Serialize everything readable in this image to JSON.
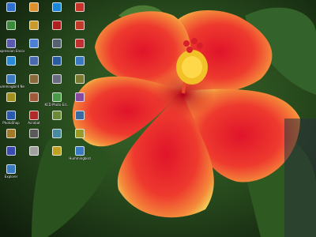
{
  "desktop": {
    "icons": [
      {
        "label": "",
        "icon": "computer-icon",
        "color": "#2f6fd0"
      },
      {
        "label": "",
        "icon": "browser-icon",
        "color": "#e0902a"
      },
      {
        "label": "",
        "icon": "media-icon",
        "color": "#1c86d8"
      },
      {
        "label": "",
        "icon": "app-icon",
        "color": "#c8342a"
      },
      {
        "label": "",
        "icon": "network-icon",
        "color": "#3a8a3a"
      },
      {
        "label": "",
        "icon": "folder-icon",
        "color": "#c79a2a"
      },
      {
        "label": "",
        "icon": "player-icon",
        "color": "#b02020"
      },
      {
        "label": "",
        "icon": "document-icon",
        "color": "#c23a2a"
      },
      {
        "label": "Expression Encoder",
        "icon": "expression-encoder-icon",
        "color": "#5a5ab0"
      },
      {
        "label": "",
        "icon": "tool-icon",
        "color": "#4c7fd6"
      },
      {
        "label": "",
        "icon": "app-icon",
        "color": "#556070"
      },
      {
        "label": "",
        "icon": "download-icon",
        "color": "#c03030"
      },
      {
        "label": "",
        "icon": "internet-explorer-icon",
        "color": "#2a8ad8"
      },
      {
        "label": "",
        "icon": "app-icon",
        "color": "#4a6ab0"
      },
      {
        "label": "",
        "icon": "app-icon",
        "color": "#2a5aa0"
      },
      {
        "label": "",
        "icon": "app-icon",
        "color": "#3a7ac0"
      },
      {
        "label": "Hummingbird Neighborhood",
        "icon": "hummingbird-icon",
        "color": "#3a7ac0"
      },
      {
        "label": "",
        "icon": "app-icon",
        "color": "#8a6a3a"
      },
      {
        "label": "",
        "icon": "app-icon",
        "color": "#6a6a80"
      },
      {
        "label": "",
        "icon": "app-icon",
        "color": "#7a7a30"
      },
      {
        "label": "",
        "icon": "app-icon",
        "color": "#a09020"
      },
      {
        "label": "",
        "icon": "app-icon",
        "color": "#a05a3a"
      },
      {
        "label": "KCD Photo Ed...",
        "icon": "photo-editor-icon",
        "color": "#4a9a4a"
      },
      {
        "label": "",
        "icon": "app-icon",
        "color": "#8a4aa0"
      },
      {
        "label": "PhotoShop",
        "icon": "photoshop-icon",
        "color": "#2a5ab0"
      },
      {
        "label": "Acrobat",
        "icon": "acrobat-icon",
        "color": "#b02a2a"
      },
      {
        "label": "",
        "icon": "app-icon",
        "color": "#6a8a3a"
      },
      {
        "label": "",
        "icon": "app-icon",
        "color": "#3a6aa0"
      },
      {
        "label": "",
        "icon": "app-icon",
        "color": "#a07a2a"
      },
      {
        "label": "",
        "icon": "app-icon",
        "color": "#5a5a5a"
      },
      {
        "label": "",
        "icon": "app-icon",
        "color": "#4a8aa0"
      },
      {
        "label": "",
        "icon": "app-icon",
        "color": "#9a9a2a"
      },
      {
        "label": "",
        "icon": "app-icon",
        "color": "#3a4ab0"
      },
      {
        "label": "",
        "icon": "app-icon",
        "color": "#a0a0a0"
      },
      {
        "label": "",
        "icon": "app-icon",
        "color": "#c0a020"
      },
      {
        "label": "Hummingbird",
        "icon": "hummingbird-icon",
        "color": "#3a7ac0"
      },
      {
        "label": "Explorer",
        "icon": "explorer-icon",
        "color": "#3a7ac0"
      }
    ]
  },
  "wallpaper": {
    "subject": "red-yellow-hibernus-flower"
  }
}
